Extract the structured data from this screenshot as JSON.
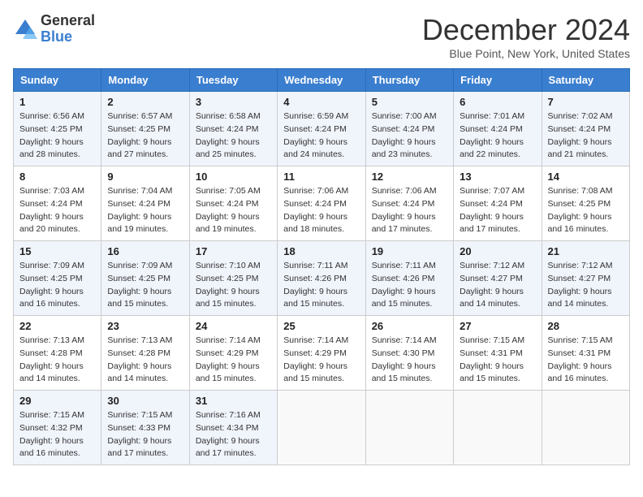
{
  "header": {
    "logo": {
      "general": "General",
      "blue": "Blue"
    },
    "title": "December 2024",
    "subtitle": "Blue Point, New York, United States"
  },
  "weekdays": [
    "Sunday",
    "Monday",
    "Tuesday",
    "Wednesday",
    "Thursday",
    "Friday",
    "Saturday"
  ],
  "weeks": [
    [
      {
        "day": 1,
        "sunrise": "6:56 AM",
        "sunset": "4:25 PM",
        "daylight": "9 hours and 28 minutes."
      },
      {
        "day": 2,
        "sunrise": "6:57 AM",
        "sunset": "4:25 PM",
        "daylight": "9 hours and 27 minutes."
      },
      {
        "day": 3,
        "sunrise": "6:58 AM",
        "sunset": "4:24 PM",
        "daylight": "9 hours and 25 minutes."
      },
      {
        "day": 4,
        "sunrise": "6:59 AM",
        "sunset": "4:24 PM",
        "daylight": "9 hours and 24 minutes."
      },
      {
        "day": 5,
        "sunrise": "7:00 AM",
        "sunset": "4:24 PM",
        "daylight": "9 hours and 23 minutes."
      },
      {
        "day": 6,
        "sunrise": "7:01 AM",
        "sunset": "4:24 PM",
        "daylight": "9 hours and 22 minutes."
      },
      {
        "day": 7,
        "sunrise": "7:02 AM",
        "sunset": "4:24 PM",
        "daylight": "9 hours and 21 minutes."
      }
    ],
    [
      {
        "day": 8,
        "sunrise": "7:03 AM",
        "sunset": "4:24 PM",
        "daylight": "9 hours and 20 minutes."
      },
      {
        "day": 9,
        "sunrise": "7:04 AM",
        "sunset": "4:24 PM",
        "daylight": "9 hours and 19 minutes."
      },
      {
        "day": 10,
        "sunrise": "7:05 AM",
        "sunset": "4:24 PM",
        "daylight": "9 hours and 19 minutes."
      },
      {
        "day": 11,
        "sunrise": "7:06 AM",
        "sunset": "4:24 PM",
        "daylight": "9 hours and 18 minutes."
      },
      {
        "day": 12,
        "sunrise": "7:06 AM",
        "sunset": "4:24 PM",
        "daylight": "9 hours and 17 minutes."
      },
      {
        "day": 13,
        "sunrise": "7:07 AM",
        "sunset": "4:24 PM",
        "daylight": "9 hours and 17 minutes."
      },
      {
        "day": 14,
        "sunrise": "7:08 AM",
        "sunset": "4:25 PM",
        "daylight": "9 hours and 16 minutes."
      }
    ],
    [
      {
        "day": 15,
        "sunrise": "7:09 AM",
        "sunset": "4:25 PM",
        "daylight": "9 hours and 16 minutes."
      },
      {
        "day": 16,
        "sunrise": "7:09 AM",
        "sunset": "4:25 PM",
        "daylight": "9 hours and 15 minutes."
      },
      {
        "day": 17,
        "sunrise": "7:10 AM",
        "sunset": "4:25 PM",
        "daylight": "9 hours and 15 minutes."
      },
      {
        "day": 18,
        "sunrise": "7:11 AM",
        "sunset": "4:26 PM",
        "daylight": "9 hours and 15 minutes."
      },
      {
        "day": 19,
        "sunrise": "7:11 AM",
        "sunset": "4:26 PM",
        "daylight": "9 hours and 15 minutes."
      },
      {
        "day": 20,
        "sunrise": "7:12 AM",
        "sunset": "4:27 PM",
        "daylight": "9 hours and 14 minutes."
      },
      {
        "day": 21,
        "sunrise": "7:12 AM",
        "sunset": "4:27 PM",
        "daylight": "9 hours and 14 minutes."
      }
    ],
    [
      {
        "day": 22,
        "sunrise": "7:13 AM",
        "sunset": "4:28 PM",
        "daylight": "9 hours and 14 minutes."
      },
      {
        "day": 23,
        "sunrise": "7:13 AM",
        "sunset": "4:28 PM",
        "daylight": "9 hours and 14 minutes."
      },
      {
        "day": 24,
        "sunrise": "7:14 AM",
        "sunset": "4:29 PM",
        "daylight": "9 hours and 15 minutes."
      },
      {
        "day": 25,
        "sunrise": "7:14 AM",
        "sunset": "4:29 PM",
        "daylight": "9 hours and 15 minutes."
      },
      {
        "day": 26,
        "sunrise": "7:14 AM",
        "sunset": "4:30 PM",
        "daylight": "9 hours and 15 minutes."
      },
      {
        "day": 27,
        "sunrise": "7:15 AM",
        "sunset": "4:31 PM",
        "daylight": "9 hours and 15 minutes."
      },
      {
        "day": 28,
        "sunrise": "7:15 AM",
        "sunset": "4:31 PM",
        "daylight": "9 hours and 16 minutes."
      }
    ],
    [
      {
        "day": 29,
        "sunrise": "7:15 AM",
        "sunset": "4:32 PM",
        "daylight": "9 hours and 16 minutes."
      },
      {
        "day": 30,
        "sunrise": "7:15 AM",
        "sunset": "4:33 PM",
        "daylight": "9 hours and 17 minutes."
      },
      {
        "day": 31,
        "sunrise": "7:16 AM",
        "sunset": "4:34 PM",
        "daylight": "9 hours and 17 minutes."
      },
      null,
      null,
      null,
      null
    ]
  ],
  "labels": {
    "sunrise": "Sunrise:",
    "sunset": "Sunset:",
    "daylight": "Daylight:"
  }
}
